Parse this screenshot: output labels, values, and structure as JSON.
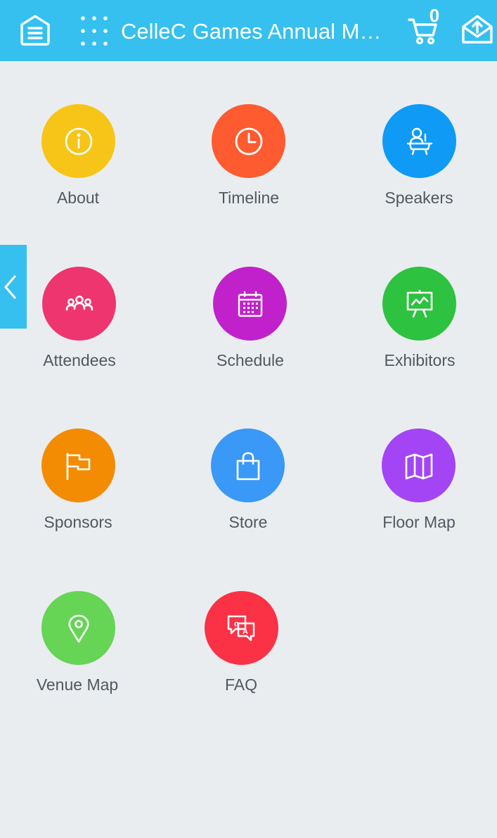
{
  "header": {
    "title": "CelleC Games Annual Me...",
    "cart_count": "0",
    "menu_icon": "menu-icon",
    "apps_icon": "apps-grid-icon",
    "cart_icon": "cart-icon",
    "share_icon": "share-icon",
    "color": "#35c0ef"
  },
  "side_tab": {
    "icon": "chevron-left-icon"
  },
  "tiles": [
    {
      "label": "About",
      "icon": "info-icon",
      "color": "#f6c518"
    },
    {
      "label": "Timeline",
      "icon": "clock-icon",
      "color": "#fe5b31"
    },
    {
      "label": "Speakers",
      "icon": "speaker-icon",
      "color": "#0e9af5"
    },
    {
      "label": "Attendees",
      "icon": "people-icon",
      "color": "#ee3570"
    },
    {
      "label": "Schedule",
      "icon": "calendar-icon",
      "color": "#c121cb"
    },
    {
      "label": "Exhibitors",
      "icon": "presentation-icon",
      "color": "#2dc23f"
    },
    {
      "label": "Sponsors",
      "icon": "flag-icon",
      "color": "#f38c02"
    },
    {
      "label": "Store",
      "icon": "shopping-bag-icon",
      "color": "#3a98f6"
    },
    {
      "label": "Floor Map",
      "icon": "map-icon",
      "color": "#a445f5"
    },
    {
      "label": "Venue Map",
      "icon": "location-pin-icon",
      "color": "#66d455"
    },
    {
      "label": "FAQ",
      "icon": "faq-icon",
      "color": "#fb3246"
    }
  ]
}
